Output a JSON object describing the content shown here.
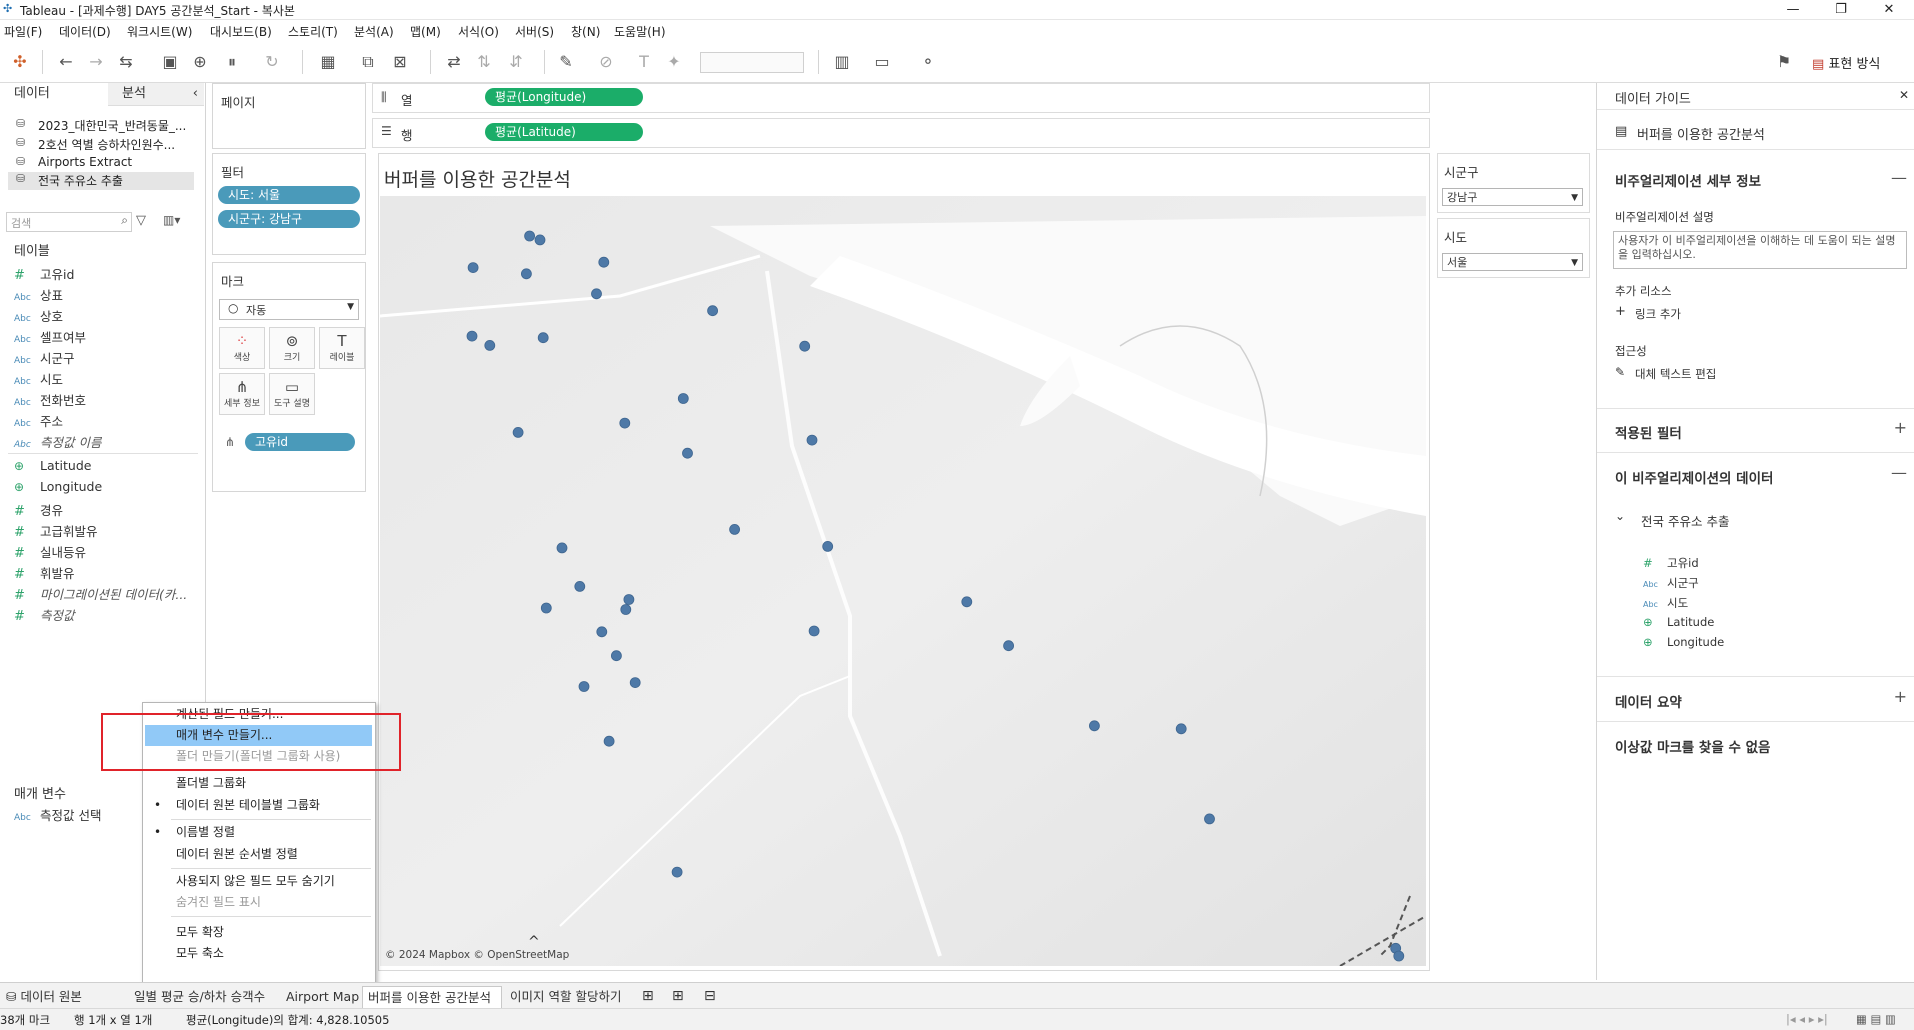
{
  "window": {
    "title": "Tableau - [과제수행] DAY5 공간분석_Start - 복사본",
    "minimize": "—",
    "maximize": "❐",
    "close": "✕"
  },
  "menu": [
    "파일(F)",
    "데이터(D)",
    "워크시트(W)",
    "대시보드(B)",
    "스토리(T)",
    "분석(A)",
    "맵(M)",
    "서식(O)",
    "서버(S)",
    "창(N)",
    "도움말(H)"
  ],
  "toolbar": {
    "show_me": "표현 방식"
  },
  "left": {
    "tab_data": "데이터",
    "tab_analysis": "분석",
    "collapse": "‹",
    "datasources": [
      "2023_대한민국_반려동물_...",
      "2호선 역별 승하차인원수...",
      "Airports Extract",
      "전국 주유소 추출"
    ],
    "search_placeholder": "검색",
    "tables_label": "테이블",
    "fields": [
      {
        "type": "#",
        "name": "고유id"
      },
      {
        "type": "Abc",
        "name": "상표"
      },
      {
        "type": "Abc",
        "name": "상호"
      },
      {
        "type": "Abc",
        "name": "셀프여부"
      },
      {
        "type": "Abc",
        "name": "시군구"
      },
      {
        "type": "Abc",
        "name": "시도"
      },
      {
        "type": "Abc",
        "name": "전화번호"
      },
      {
        "type": "Abc",
        "name": "주소"
      },
      {
        "type": "Abc",
        "name": "측정값 이름"
      },
      {
        "type": "geo",
        "name": "Latitude"
      },
      {
        "type": "geo",
        "name": "Longitude"
      },
      {
        "type": "#",
        "name": "경유"
      },
      {
        "type": "#",
        "name": "고급휘발유"
      },
      {
        "type": "#",
        "name": "실내등유"
      },
      {
        "type": "#",
        "name": "휘발유"
      },
      {
        "type": "#",
        "name": "마이그레이션된 데이터(카..."
      },
      {
        "type": "#",
        "name": "측정값"
      }
    ],
    "params_label": "매개 변수",
    "param_type": "Abc",
    "param_item": "측정값 선택"
  },
  "shelves": {
    "pages_label": "페이지",
    "filters_label": "필터",
    "filter_pills": [
      "시도: 서울",
      "시군구: 강남구"
    ],
    "marks_label": "마크",
    "mark_type": "자동",
    "mark_buttons": [
      "색상",
      "크기",
      "레이블",
      "세부 정보",
      "도구 설명"
    ],
    "detail_pill": "고유id",
    "columns_label": "열",
    "rows_label": "행",
    "columns_pill": "평균(Longitude)",
    "rows_pill": "평균(Latitude)"
  },
  "viz": {
    "title": "버퍼를 이용한 공간분석",
    "attribution": "© 2024 Mapbox © OpenStreetMap"
  },
  "quick_filters": [
    {
      "label": "시군구",
      "value": "강남구"
    },
    {
      "label": "시도",
      "value": "서울"
    }
  ],
  "map_points": [
    [
      0.143,
      0.052
    ],
    [
      0.153,
      0.057
    ],
    [
      0.214,
      0.086
    ],
    [
      0.089,
      0.093
    ],
    [
      0.14,
      0.101
    ],
    [
      0.207,
      0.127
    ],
    [
      0.318,
      0.149
    ],
    [
      0.088,
      0.182
    ],
    [
      0.156,
      0.184
    ],
    [
      0.105,
      0.194
    ],
    [
      0.406,
      0.195
    ],
    [
      0.29,
      0.263
    ],
    [
      0.234,
      0.295
    ],
    [
      0.132,
      0.307
    ],
    [
      0.413,
      0.317
    ],
    [
      0.294,
      0.334
    ],
    [
      0.339,
      0.433
    ],
    [
      0.174,
      0.457
    ],
    [
      0.428,
      0.455
    ],
    [
      0.191,
      0.507
    ],
    [
      0.238,
      0.524
    ],
    [
      0.561,
      0.527
    ],
    [
      0.159,
      0.535
    ],
    [
      0.235,
      0.537
    ],
    [
      0.212,
      0.566
    ],
    [
      0.415,
      0.565
    ],
    [
      0.226,
      0.597
    ],
    [
      0.601,
      0.584
    ],
    [
      0.244,
      0.632
    ],
    [
      0.195,
      0.637
    ],
    [
      0.683,
      0.688
    ],
    [
      0.766,
      0.692
    ],
    [
      0.219,
      0.708
    ],
    [
      0.793,
      0.809
    ],
    [
      0.284,
      0.878
    ],
    [
      0.971,
      0.977
    ],
    [
      0.974,
      0.987
    ]
  ],
  "guide": {
    "title": "데이터 가이드",
    "close": "✕",
    "sheet_name": "버퍼를 이용한 공간분석",
    "viz_details": "비주얼리제이션 세부 정보",
    "desc_label": "비주얼리제이션 설명",
    "desc_placeholder": "사용자가 이 비주얼리제이션을 이해하는 데 도움이 되는 설명을 입력하십시오.",
    "resources_label": "추가 리소스",
    "add_link": "링크 추가",
    "accessibility_label": "접근성",
    "alt_text": "대체 텍스트 편집",
    "applied_filters": "적용된 필터",
    "data_in_viz": "이 비주얼리제이션의 데이터",
    "datasource": "전국 주유소 추출",
    "fields": [
      {
        "type": "#",
        "name": "고유id"
      },
      {
        "type": "Abc",
        "name": "시군구"
      },
      {
        "type": "Abc",
        "name": "시도"
      },
      {
        "type": "geo",
        "name": "Latitude"
      },
      {
        "type": "geo",
        "name": "Longitude"
      }
    ],
    "data_summary": "데이터 요약",
    "outliers": "이상값 마크를 찾을 수 없음",
    "plus": "+",
    "minus": "—"
  },
  "context_menu": {
    "items": [
      {
        "label": "계산된 필드 만들기...",
        "state": "normal"
      },
      {
        "label": "매개 변수 만들기...",
        "state": "highlight"
      },
      {
        "label": "폴더 만들기(폴더별 그룹화 사용)",
        "state": "disabled"
      },
      {
        "label": "폴더별 그룹화",
        "state": "normal"
      },
      {
        "label": "데이터 원본 테이블별 그룹화",
        "state": "checked"
      },
      {
        "label": "이름별 정렬",
        "state": "checked"
      },
      {
        "label": "데이터 원본 순서별 정렬",
        "state": "normal"
      },
      {
        "label": "사용되지 않은 필드 모두 숨기기",
        "state": "normal"
      },
      {
        "label": "숨겨진 필드 표시",
        "state": "disabled"
      },
      {
        "label": "모두 확장",
        "state": "normal"
      },
      {
        "label": "모두 축소",
        "state": "normal"
      }
    ]
  },
  "sheet_tabs": [
    "데이터 원본",
    "일별 평균 승/하차 승객수",
    "Airport Map",
    "버퍼를 이용한 공간분석",
    "이미지 역할 할당하기"
  ],
  "active_tab": "버퍼를 이용한 공간분석",
  "status": {
    "marks": "38개 마크",
    "rows_cols": "행 1개 x 열 1개",
    "sum": "평균(Longitude)의 합계: 4,828.10505"
  }
}
